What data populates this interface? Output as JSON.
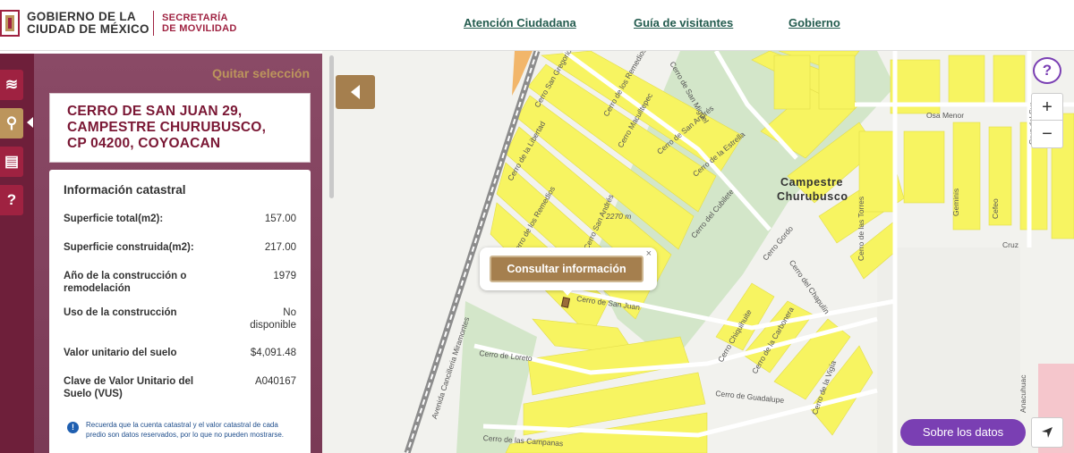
{
  "header": {
    "gov_line1": "GOBIERNO DE LA",
    "gov_line2": "CIUDAD DE MÉXICO",
    "sec_line1": "SECRETARÍA",
    "sec_line2": "DE MOVILIDAD",
    "nav": [
      {
        "label": "Atención Ciudadana"
      },
      {
        "label": "Guía de visitantes"
      },
      {
        "label": "Gobierno"
      }
    ]
  },
  "rail": {
    "items": [
      {
        "name": "layers-icon",
        "glyph": "≋"
      },
      {
        "name": "search-icon",
        "glyph": "⚲"
      },
      {
        "name": "clipboard-icon",
        "glyph": "▤"
      },
      {
        "name": "help-icon",
        "glyph": "?"
      }
    ]
  },
  "panel": {
    "quitar": "Quitar selección",
    "address": [
      "CERRO DE SAN JUAN 29,",
      "CAMPESTRE CHURUBUSCO,",
      "CP 04200, COYOACAN"
    ],
    "info_title": "Información catastral",
    "rows": [
      {
        "label": "Superficie total(m2):",
        "value": "157.00"
      },
      {
        "label": "Superficie construida(m2):",
        "value": "217.00"
      },
      {
        "label": "Año de la construcción o remodelación",
        "value": "1979"
      },
      {
        "label": "Uso de la construcción",
        "value": "No disponible"
      },
      {
        "label": "Valor unitario del suelo",
        "value": "$4,091.48"
      },
      {
        "label": "Clave de Valor Unitario del Suelo (VUS)",
        "value": "A040167"
      }
    ],
    "note": "Recuerda que la cuenta catastral y el valor catastral de cada predio son datos reservados, por lo que no pueden mostrarse."
  },
  "map": {
    "help_label": "?",
    "zoom_in": "+",
    "zoom_out": "−",
    "popup_close": "×",
    "popup_button": "Consultar información",
    "sobre": "Sobre los datos",
    "area_label_1": "Campestre",
    "area_label_2": "Churubusco",
    "distance_label": "2270 m",
    "streets": [
      "Cerro San Gregorio",
      "Cerro de los Remedios",
      "Cerro de San Miguel",
      "Osa Menor",
      "Cerro Maculltepec",
      "Cerro de San Andrés",
      "Cerro de la Estrella",
      "Cerro de la Libertad",
      "Cerro de los Remedios",
      "Cerro San Andrés",
      "Cerro del Cubilete",
      "Cerro Gordo",
      "Cerro del Chapulín",
      "Cerro de las Torres",
      "Cerro de San Juan",
      "Avenida Cancilleria Miramontes",
      "Cerro de Loreto",
      "Cerro Chiquihuite",
      "Cerro de la Carbonera",
      "Cerro de la Vigía",
      "Cerro de Guadalupe",
      "Cerro de las Campanas",
      "Anacuhuac",
      "Geminis",
      "Cefeo",
      "Cruz del Sur",
      "Cruz"
    ]
  },
  "colors": {
    "lot_yellow": "#f7f461",
    "park_green": "#d3e6c9",
    "guinda": "#9f2241",
    "gold": "#bc955c",
    "purple": "#7a3fb3"
  }
}
